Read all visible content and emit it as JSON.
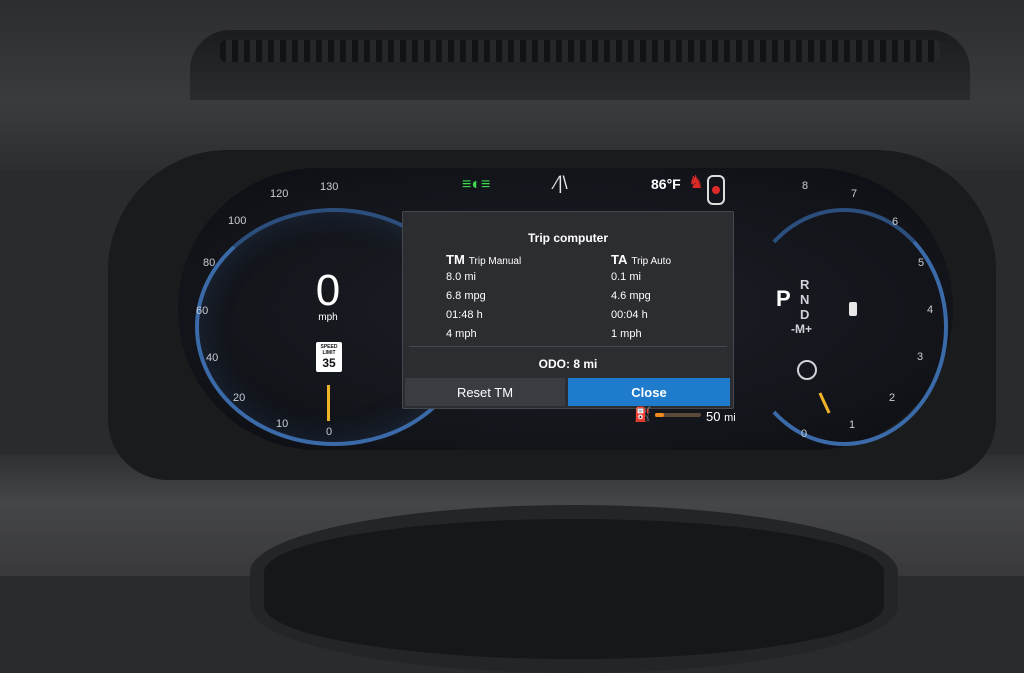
{
  "speedometer": {
    "value": "0",
    "unit": "mph",
    "ticks": [
      "0",
      "10",
      "20",
      "40",
      "60",
      "80",
      "100",
      "120",
      "130"
    ],
    "speed_limit_label": "SPEED LIMIT",
    "speed_limit_value": "35"
  },
  "tachometer": {
    "ticks": [
      "0",
      "1",
      "2",
      "3",
      "4",
      "5",
      "6",
      "7",
      "8"
    ]
  },
  "status_bar": {
    "outside_temp": "86°F"
  },
  "gear_selector": {
    "current": "P",
    "options": [
      "R",
      "N",
      "D"
    ],
    "manual": "-M+"
  },
  "trip_computer": {
    "title": "Trip computer",
    "manual": {
      "code": "TM",
      "label": "Trip Manual",
      "distance": "8.0 mi",
      "consumption": "6.8 mpg",
      "time": "01:48 h",
      "avg_speed": "4 mph"
    },
    "auto": {
      "code": "TA",
      "label": "Trip Auto",
      "distance": "0.1 mi",
      "consumption": "4.6 mpg",
      "time": "00:04 h",
      "avg_speed": "1 mph"
    },
    "odo_label": "ODO:",
    "odo_value": "8 mi",
    "reset_label": "Reset TM",
    "close_label": "Close"
  },
  "fuel": {
    "range_value": "50",
    "range_unit": "mi",
    "level_fraction": 0.2
  },
  "colors": {
    "accent_blue": "#1f7ccc",
    "ring_blue": "#3b6aa8",
    "needle": "#f0b429",
    "warning_red": "#e02a2a",
    "lights_green": "#3ddc4f",
    "fuel_orange": "#f08a1c"
  },
  "icons": [
    "lights-icon",
    "road-icon",
    "seatbelt-icon",
    "car-icon",
    "fuel-pump-icon",
    "battery-icon",
    "gauge-icon"
  ]
}
